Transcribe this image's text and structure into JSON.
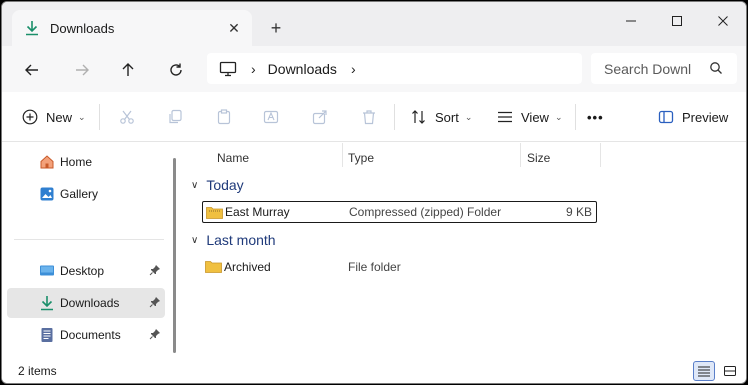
{
  "window": {
    "tab_title": "Downloads",
    "new_tab_label": "+",
    "close_tab_label": "✕"
  },
  "address": {
    "crumbs": [
      "Downloads"
    ],
    "search_placeholder": "Search Downl"
  },
  "commands": {
    "new": "New",
    "sort": "Sort",
    "view": "View",
    "more": "•••",
    "preview": "Preview"
  },
  "sidebar": {
    "items": [
      {
        "label": "Home",
        "icon": "home-icon"
      },
      {
        "label": "Gallery",
        "icon": "gallery-icon"
      },
      {
        "label": "Desktop",
        "icon": "desktop-icon",
        "pinned": true
      },
      {
        "label": "Downloads",
        "icon": "download-icon",
        "pinned": true,
        "selected": true
      },
      {
        "label": "Documents",
        "icon": "documents-icon",
        "pinned": true
      }
    ]
  },
  "list": {
    "columns": [
      "Name",
      "Type",
      "Size"
    ],
    "groups": [
      {
        "label": "Today",
        "rows": [
          {
            "name": "East Murray",
            "type": "Compressed (zipped) Folder",
            "size": "9 KB",
            "icon": "zip-folder-icon"
          }
        ]
      },
      {
        "label": "Last month",
        "rows": [
          {
            "name": "Archived",
            "type": "File folder",
            "size": "",
            "icon": "folder-icon"
          }
        ]
      }
    ]
  },
  "status": {
    "item_count": "2 items"
  },
  "colors": {
    "accent": "#1a7f5a",
    "group_heading": "#1f3a7a",
    "folder": "#f0c040"
  }
}
